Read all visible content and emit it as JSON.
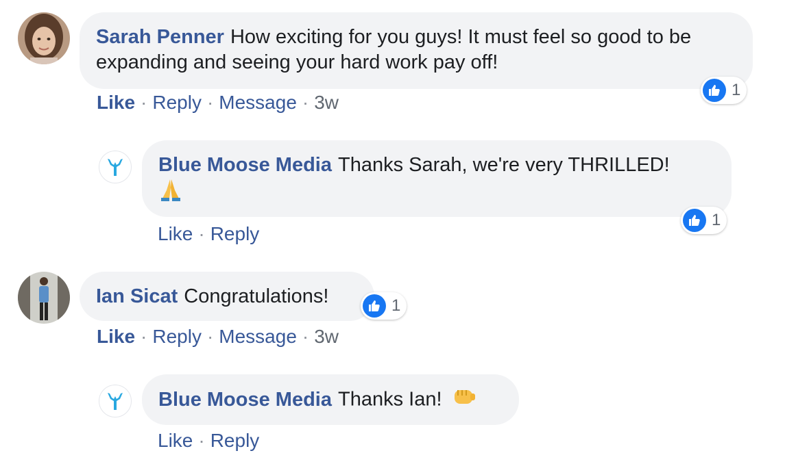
{
  "comments": [
    {
      "author": "Sarah Penner",
      "text": "How exciting for you guys! It must feel so good to be expanding and seeing your hard work pay off!",
      "actions": {
        "like": "Like",
        "reply": "Reply",
        "message": "Message",
        "time": "3w"
      },
      "reaction_count": "1",
      "reply": {
        "author": "Blue Moose Media",
        "text": "Thanks Sarah, we're very THRILLED!",
        "emoji": "folded-hands-emoji",
        "actions": {
          "like": "Like",
          "reply": "Reply"
        },
        "reaction_count": "1"
      }
    },
    {
      "author": "Ian Sicat",
      "text": "Congratulations!",
      "actions": {
        "like": "Like",
        "reply": "Reply",
        "message": "Message",
        "time": "3w"
      },
      "reaction_count": "1",
      "reply": {
        "author": "Blue Moose Media",
        "text": "Thanks Ian!",
        "emoji": "fist-bump-emoji",
        "actions": {
          "like": "Like",
          "reply": "Reply"
        }
      }
    }
  ],
  "separator": "·",
  "colors": {
    "author": "#385898",
    "bubble": "#f2f3f5",
    "like_reaction": "#1877f2",
    "brand_logo": "#29a8e0"
  }
}
